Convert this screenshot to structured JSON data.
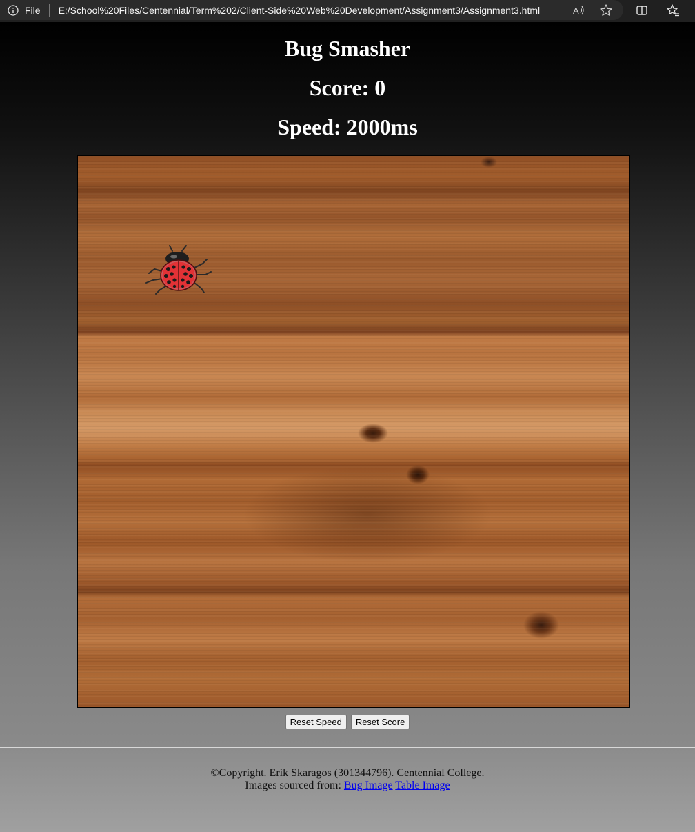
{
  "browser": {
    "file_label": "File",
    "url": "E:/School%20Files/Centennial/Term%202/Client-Side%20Web%20Development/Assignment3/Assignment3.html",
    "icons": [
      "info-icon",
      "read-aloud-icon",
      "favorite-star-icon",
      "split-screen-icon",
      "favorites-icon"
    ]
  },
  "game": {
    "title": "Bug Smasher",
    "score_label": "Score: 0",
    "speed_label": "Speed: 2000ms",
    "bug_icon": "ladybug-icon"
  },
  "controls": {
    "reset_speed_label": "Reset Speed",
    "reset_score_label": "Reset Score"
  },
  "footer": {
    "copyright": "©Copyright. Erik Skaragos (301344796). Centennial College.",
    "images_prefix": "Images sourced from:",
    "bug_link": "Bug Image",
    "table_link": "Table Image"
  },
  "colors": {
    "browser_bar": "#202020",
    "heading_text": "#ffffff",
    "link": "#0000ee"
  }
}
